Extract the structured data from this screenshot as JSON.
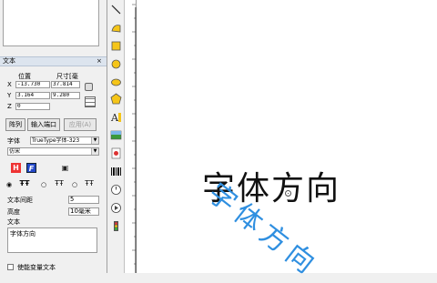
{
  "panel": {
    "title": "文本",
    "close": "×",
    "columns": {
      "position": "位置",
      "size": "尺寸[毫"
    },
    "x_label": "X",
    "y_label": "Y",
    "z_label": "Z",
    "x_value": "-13.730",
    "y_value": "3.164",
    "z_value": "0",
    "width_value": "37.814",
    "height_value": "9.280"
  },
  "buttons": {
    "array": "阵列",
    "input_port": "输入端口",
    "apply": "应用(A)"
  },
  "font": {
    "label": "字体",
    "type_value": "TrueType字体-323",
    "name_value": "仿宋"
  },
  "spacing": {
    "label": "文本间距",
    "value": "5"
  },
  "height": {
    "label": "高度",
    "value": "10毫米"
  },
  "text": {
    "label": "文本",
    "value": "字体方向"
  },
  "variable_text": {
    "label": "使能变量文本"
  },
  "canvas": {
    "horizontal_text": "字体方向",
    "rotated_text": "字体方向",
    "accent": "#2f8fe0"
  }
}
